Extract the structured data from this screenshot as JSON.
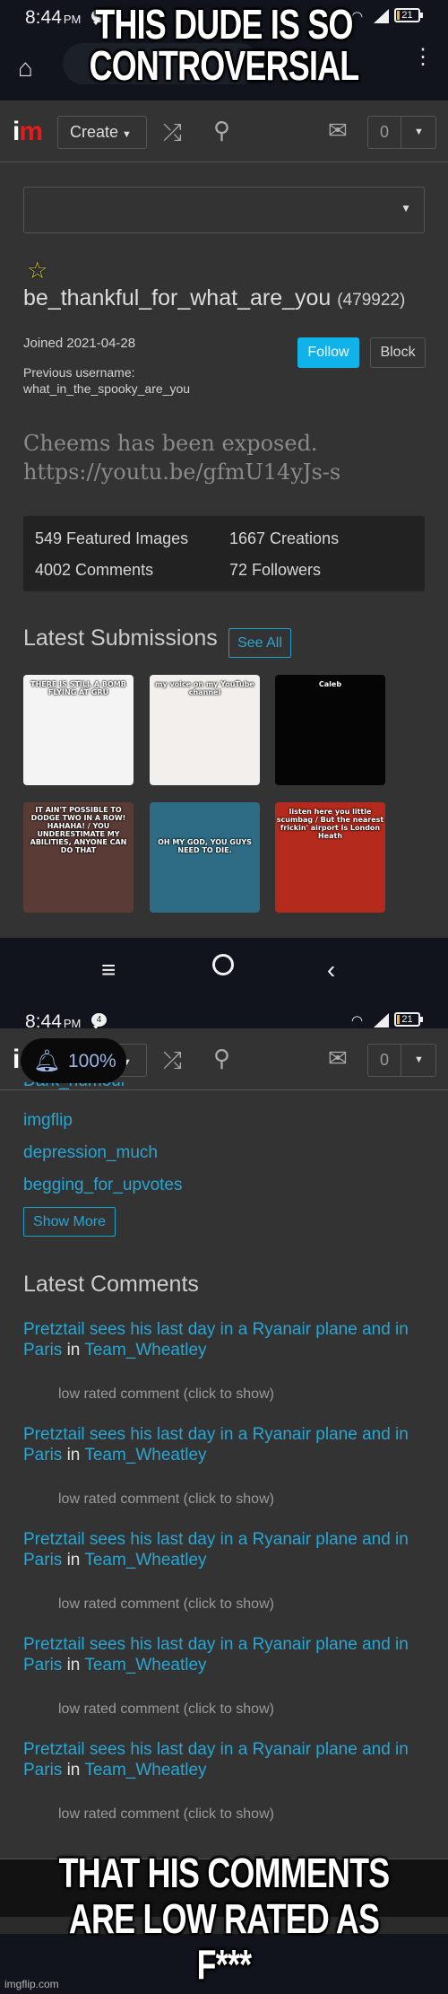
{
  "meme": {
    "top_text": "THIS DUDE IS SO CONTROVERSIAL",
    "bottom_text": "THAT HIS COMMENTS ARE LOW RATED AS F***",
    "watermark": "imgflip.com"
  },
  "status_bar": {
    "time": "8:44",
    "ampm": "PM",
    "notification_count": "4",
    "battery": "21"
  },
  "nav": {
    "logo_i": "i",
    "logo_m": "m",
    "create_label": "Create",
    "notification_count": "0",
    "icons": [
      "shuffle-icon",
      "search-icon",
      "mail-icon"
    ]
  },
  "profile": {
    "username": "be_thankful_for_what_are_you",
    "points": "(479922)",
    "joined": "Joined 2021-04-28",
    "previous_username_label": "Previous username:",
    "previous_username": "what_in_the_spooky_are_you",
    "follow_label": "Follow",
    "block_label": "Block",
    "bio_line1": "Cheems has been exposed.",
    "bio_line2": "https://youtu.be/gfmU14yJs-s"
  },
  "stats": [
    "549 Featured Images",
    "1667 Creations",
    "4002 Comments",
    "72 Followers"
  ],
  "submissions": {
    "title": "Latest Submissions",
    "see_all_label": "See All",
    "items": [
      {
        "caption": "THERE IS STILL A BOMB FLYING AT GRU",
        "bg": "#f4f4f4"
      },
      {
        "caption": "my voice on my YouTube channel",
        "bg": "#f2efec"
      },
      {
        "caption": "Caleb",
        "bg": "#050505"
      },
      {
        "caption": "IT AIN'T POSSIBLE TO DODGE TWO IN A ROW! HAHAHA! / YOU UNDERESTIMATE MY ABILITIES, ANYONE CAN DO THAT",
        "bg": "#5a3b36"
      },
      {
        "caption": "OH MY GOD, YOU GUYS NEED TO DIE.",
        "bg": "#2d6c84"
      },
      {
        "caption": "listen here you little scumbag / But the nearest frickin' airport is London Heath",
        "bg": "#b42a1c"
      }
    ]
  },
  "tags": {
    "partial": "Dark_humour",
    "items": [
      "imgflip",
      "depression_much",
      "begging_for_upvotes"
    ],
    "show_more_label": "Show More"
  },
  "comments": {
    "title": "Latest Comments",
    "items": [
      {
        "post": "Pretztail sees his last day in a Ryanair plane and in Paris",
        "in": "in",
        "stream": "Team_Wheatley",
        "body": "low rated comment (click to show)"
      },
      {
        "post": "Pretztail sees his last day in a Ryanair plane and in Paris",
        "in": "in",
        "stream": "Team_Wheatley",
        "body": "low rated comment (click to show)"
      },
      {
        "post": "Pretztail sees his last day in a Ryanair plane and in Paris",
        "in": "in",
        "stream": "Team_Wheatley",
        "body": "low rated comment (click to show)"
      },
      {
        "post": "Pretztail sees his last day in a Ryanair plane and in Paris",
        "in": "in",
        "stream": "Team_Wheatley",
        "body": "low rated comment (click to show)"
      },
      {
        "post": "Pretztail sees his last day in a Ryanair plane and in Paris",
        "in": "in",
        "stream": "Team_Wheatley",
        "body": "low rated comment (click to show)"
      }
    ]
  },
  "volume_toast": {
    "percent": "100%"
  },
  "colors": {
    "accent": "#27a6d4",
    "follow": "#0fb3ea",
    "logo_m": "#e41b1b",
    "background": "#333333"
  }
}
